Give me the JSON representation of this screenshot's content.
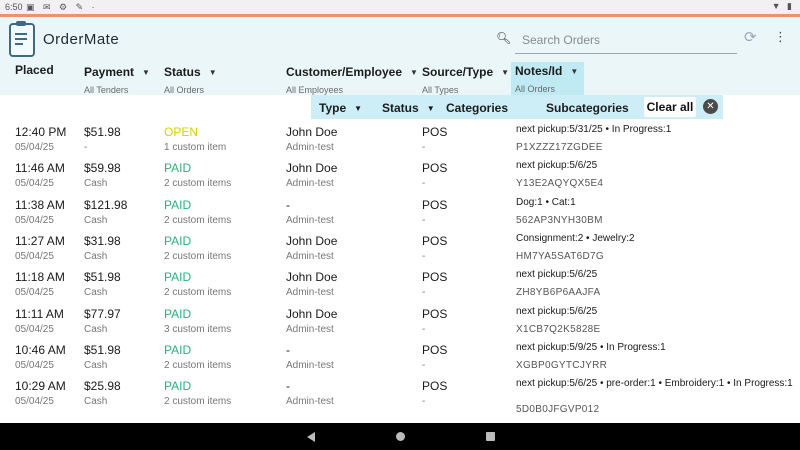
{
  "status_bar": {
    "time": "6:50"
  },
  "app": {
    "title": "OrderMate"
  },
  "search": {
    "placeholder": "Search Orders",
    "value": ""
  },
  "columns": [
    {
      "key": "placed",
      "title": "Placed",
      "sub": ""
    },
    {
      "key": "payment",
      "title": "Payment",
      "sub": "All Tenders"
    },
    {
      "key": "status",
      "title": "Status",
      "sub": "All Orders"
    },
    {
      "key": "customer",
      "title": "Customer/Employee",
      "sub": "All Employees"
    },
    {
      "key": "source",
      "title": "Source/Type",
      "sub": "All Types"
    },
    {
      "key": "notes",
      "title": "Notes/Id",
      "sub": "All Orders"
    }
  ],
  "filters": {
    "type_label": "Type",
    "status_label": "Status",
    "categories_label": "Categories",
    "subcategories_label": "Subcategories",
    "clear_label": "Clear all"
  },
  "orders": [
    {
      "time": "12:40 PM",
      "date": "05/04/25",
      "amount": "$51.98",
      "tender": "-",
      "status": "OPEN",
      "items": "1 custom item",
      "customer": "John Doe",
      "employee": "Admin-test",
      "source": "POS",
      "source_sub": "-",
      "note": "next pickup:5/31/25 • In Progress:1",
      "code": "P1XZZZ17ZGDEE"
    },
    {
      "time": "11:46 AM",
      "date": "05/04/25",
      "amount": "$59.98",
      "tender": "Cash",
      "status": "PAID",
      "items": "2 custom items",
      "customer": "John Doe",
      "employee": "Admin-test",
      "source": "POS",
      "source_sub": "-",
      "note": "next pickup:5/6/25",
      "code": "Y13E2AQYQX5E4"
    },
    {
      "time": "11:38 AM",
      "date": "05/04/25",
      "amount": "$121.98",
      "tender": "Cash",
      "status": "PAID",
      "items": "2 custom items",
      "customer": "-",
      "employee": "Admin-test",
      "source": "POS",
      "source_sub": "-",
      "note": "Dog:1 • Cat:1",
      "code": "562AP3NYH30BM"
    },
    {
      "time": "11:27 AM",
      "date": "05/04/25",
      "amount": "$31.98",
      "tender": "Cash",
      "status": "PAID",
      "items": "2 custom items",
      "customer": "John Doe",
      "employee": "Admin-test",
      "source": "POS",
      "source_sub": "-",
      "note": "Consignment:2 • Jewelry:2",
      "code": "HM7YA5SAT6D7G"
    },
    {
      "time": "11:18 AM",
      "date": "05/04/25",
      "amount": "$51.98",
      "tender": "Cash",
      "status": "PAID",
      "items": "2 custom items",
      "customer": "John Doe",
      "employee": "Admin-test",
      "source": "POS",
      "source_sub": "-",
      "note": "next pickup:5/6/25",
      "code": "ZH8YB6P6AAJFA"
    },
    {
      "time": "11:11 AM",
      "date": "05/04/25",
      "amount": "$77.97",
      "tender": "Cash",
      "status": "PAID",
      "items": "3 custom items",
      "customer": "John Doe",
      "employee": "Admin-test",
      "source": "POS",
      "source_sub": "-",
      "note": "next pickup:5/6/25",
      "code": "X1CB7Q2K5828E"
    },
    {
      "time": "10:46 AM",
      "date": "05/04/25",
      "amount": "$51.98",
      "tender": "Cash",
      "status": "PAID",
      "items": "2 custom items",
      "customer": "-",
      "employee": "Admin-test",
      "source": "POS",
      "source_sub": "-",
      "note": "next pickup:5/9/25 • In Progress:1",
      "code": "XGBP0GYTCJYRR"
    },
    {
      "time": "10:29 AM",
      "date": "05/04/25",
      "amount": "$25.98",
      "tender": "Cash",
      "status": "PAID",
      "items": "2 custom items",
      "customer": "-",
      "employee": "Admin-test",
      "source": "POS",
      "source_sub": "-",
      "note": "next pickup:5/6/25 • pre-order:1 • Embroidery:1 • In Progress:1",
      "code": "5D0B0JFGVP012"
    }
  ],
  "colors": {
    "paid": "#2cb07c",
    "open": "#d9cf00",
    "header_bg": "#eaf6f8",
    "accent": "#e8956a",
    "filter_bg": "#cdeef6"
  },
  "icons": [
    "search-icon",
    "refresh-icon",
    "more-vert-icon",
    "close-icon",
    "back-icon",
    "home-icon",
    "recents-icon"
  ]
}
